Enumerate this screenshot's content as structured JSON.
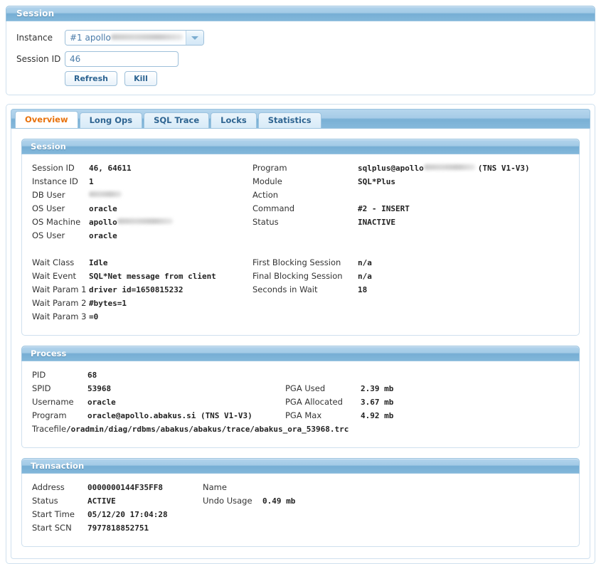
{
  "window": {
    "title": "Session"
  },
  "form": {
    "instance_label": "Instance",
    "instance_value": "#1 apollo",
    "instance_redacted": true,
    "session_id_label": "Session ID",
    "session_id_value": "46",
    "session_id_placeholder": "Session ID",
    "refresh_label": "Refresh",
    "kill_label": "Kill",
    "caret_icon": "chevron-down-icon"
  },
  "tabs": [
    {
      "label": "Overview",
      "active": true
    },
    {
      "label": "Long Ops",
      "active": false
    },
    {
      "label": "SQL Trace",
      "active": false
    },
    {
      "label": "Locks",
      "active": false
    },
    {
      "label": "Statistics",
      "active": false
    }
  ],
  "panels": {
    "session": {
      "title": "Session",
      "left": [
        {
          "key": "Session ID",
          "value": "46, 64611"
        },
        {
          "key": "Instance ID",
          "value": "1"
        },
        {
          "key": "DB User",
          "value": "",
          "redacted": true,
          "redact_width": 46
        },
        {
          "key": "OS User",
          "value": "oracle"
        },
        {
          "key": "OS Machine",
          "value": "apollo",
          "redacted": true,
          "redact_width": 78
        },
        {
          "key": "OS User",
          "value": "oracle"
        },
        {
          "key": "",
          "value": ""
        },
        {
          "key": "Wait Class",
          "value": "Idle"
        },
        {
          "key": "Wait Event",
          "value": "SQL*Net message from client"
        },
        {
          "key": "Wait Param 1",
          "value": "driver id=1650815232"
        },
        {
          "key": "Wait Param 2",
          "value": "#bytes=1"
        },
        {
          "key": "Wait Param 3",
          "value": "=0"
        }
      ],
      "right": [
        {
          "key": "Program",
          "value": "sqlplus@apollo",
          "redacted": true,
          "redact_width": 72,
          "suffix": "(TNS V1-V3)"
        },
        {
          "key": "Module",
          "value": "SQL*Plus"
        },
        {
          "key": "Action",
          "value": ""
        },
        {
          "key": "Command",
          "value": "#2 - INSERT"
        },
        {
          "key": "Status",
          "value": "INACTIVE"
        },
        {
          "key": "",
          "value": ""
        },
        {
          "key": "",
          "value": ""
        },
        {
          "key": "First Blocking Session",
          "value": "n/a"
        },
        {
          "key": "Final Blocking Session",
          "value": "n/a"
        },
        {
          "key": "Seconds in Wait",
          "value": "18"
        }
      ]
    },
    "process": {
      "title": "Process",
      "left": [
        {
          "key": "PID",
          "value": "68"
        },
        {
          "key": "SPID",
          "value": "53968"
        },
        {
          "key": "Username",
          "value": "oracle"
        },
        {
          "key": "Program",
          "value": "oracle@apollo.abakus.si (TNS V1-V3)"
        },
        {
          "key": "Tracefile",
          "value": "/oradmin/diag/rdbms/abakus/abakus/trace/abakus_ora_53968.trc",
          "fullwidth": true
        }
      ],
      "right": [
        {
          "key": "",
          "value": ""
        },
        {
          "key": "PGA Used",
          "value": "2.39 mb"
        },
        {
          "key": "PGA Allocated",
          "value": "3.67 mb"
        },
        {
          "key": "PGA Max",
          "value": "4.92 mb"
        }
      ]
    },
    "transaction": {
      "title": "Transaction",
      "left": [
        {
          "key": "Address",
          "value": "0000000144F35FF8"
        },
        {
          "key": "Status",
          "value": "ACTIVE"
        },
        {
          "key": "Start Time",
          "value": "05/12/20 17:04:28"
        },
        {
          "key": "Start SCN",
          "value": "7977818852751"
        }
      ],
      "right": [
        {
          "key": "Name",
          "value": ""
        },
        {
          "key": "Undo Usage",
          "value": "0.49 mb"
        }
      ]
    }
  },
  "colors": {
    "header_blue_top": "#b3d4ec",
    "header_blue_bottom": "#82b7da",
    "active_tab_text": "#e8720c",
    "tab_text": "#2e6491",
    "panel_border": "#cfe0ee",
    "input_text": "#4a7ba8"
  }
}
